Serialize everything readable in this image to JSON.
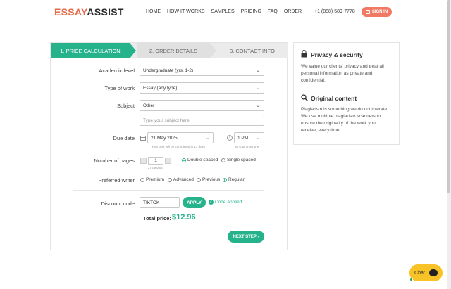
{
  "header": {
    "logo_part1": "ESSAY",
    "logo_part2": "ASSIST",
    "nav": [
      "HOME",
      "HOW IT WORKS",
      "SAMPLES",
      "PRICING",
      "FAQ",
      "ORDER"
    ],
    "phone": "+1 (888) 589-7778",
    "signin_label": "SIGN IN"
  },
  "steps": [
    "1. PRICE CALCULATION",
    "2. ORDER DETAILS",
    "3. CONTACT INFO"
  ],
  "form": {
    "academic_level_label": "Academic level",
    "academic_level_value": "Undergraduate (yrs. 1-2)",
    "type_of_work_label": "Type of work",
    "type_of_work_value": "Essay (any type)",
    "subject_label": "Subject",
    "subject_value": "Other",
    "subject_placeholder": "Type your subject here",
    "due_date_label": "Due date",
    "due_date_value": "21 May 2025",
    "due_date_hint": "Your task will be completed in 13 days",
    "due_time_value": "1 PM",
    "due_time_hint": "In your timezone",
    "pages_label": "Number of pages",
    "pages_value": "1",
    "pages_hint": "275 words",
    "spacing_double": "Double spaced",
    "spacing_single": "Single spaced",
    "writer_label": "Preferred writer",
    "writer_premium": "Premium",
    "writer_advanced": "Advanced",
    "writer_previous": "Previous",
    "writer_regular": "Regular",
    "discount_label": "Discount code",
    "discount_value": "TIKTOK",
    "apply_label": "APPLY",
    "applied_text": "Code applied",
    "total_label": "Total price:",
    "total_value": "$12.96",
    "next_label": "NEXT STEP ›"
  },
  "side": {
    "privacy_title": "Privacy & security",
    "privacy_text": "We value our clients' privacy and treat all personal information as private and confidential.",
    "original_title": "Original content",
    "original_text": "Plagiarism is something we do not tolerate. We use multiple plagiarism scanners to ensure the originality of the work you receive, every time."
  },
  "chat": {
    "label": "Chat"
  },
  "colors": {
    "accent": "#26b28b",
    "brand": "#e8684a",
    "signin": "#f07a63",
    "chat": "#f7c326"
  }
}
